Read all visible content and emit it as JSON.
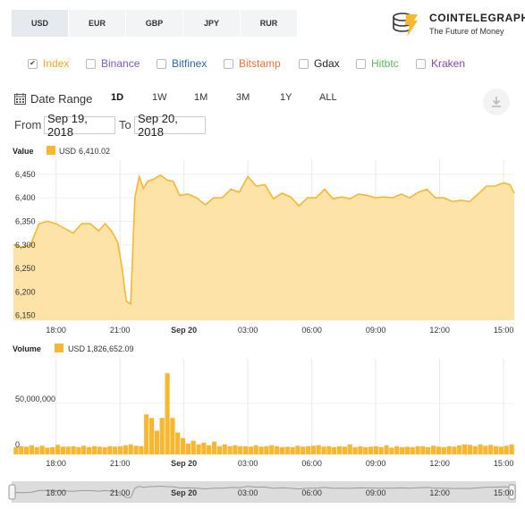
{
  "currency_tabs": [
    {
      "label": "USD",
      "active": true
    },
    {
      "label": "EUR",
      "active": false
    },
    {
      "label": "GBP",
      "active": false
    },
    {
      "label": "JPY",
      "active": false
    },
    {
      "label": "RUR",
      "active": false
    }
  ],
  "brand": {
    "name": "COINTELEGRAPH",
    "tagline": "The Future of Money",
    "accent": "#f7b731"
  },
  "exchanges": [
    {
      "label": "Index",
      "checked": true,
      "color": "#f5a623"
    },
    {
      "label": "Binance",
      "checked": false,
      "color": "#7e57c2"
    },
    {
      "label": "Bitfinex",
      "checked": false,
      "color": "#2c6aa0"
    },
    {
      "label": "Bitstamp",
      "checked": false,
      "color": "#f0703a"
    },
    {
      "label": "Gdax",
      "checked": false,
      "color": "#222222"
    },
    {
      "label": "Hitbtc",
      "checked": false,
      "color": "#5cb85c"
    },
    {
      "label": "Kraken",
      "checked": false,
      "color": "#8e44ad"
    }
  ],
  "date_range": {
    "label": "Date Range",
    "ranges": [
      "1D",
      "1W",
      "1M",
      "3M",
      "1Y",
      "ALL"
    ],
    "active": "1D",
    "from_label": "From",
    "from_value": "Sep 19, 2018",
    "to_label": "To",
    "to_value": "Sep 20, 2018"
  },
  "chart_data": [
    {
      "type": "area",
      "title": "Value",
      "legend": {
        "name": "USD",
        "value": "6,410.02"
      },
      "x_ticks": [
        "18:00",
        "21:00",
        "Sep 20",
        "03:00",
        "06:00",
        "09:00",
        "12:00",
        "15:00"
      ],
      "y_ticks": [
        "6,150",
        "6,200",
        "6,250",
        "6,300",
        "6,350",
        "6,400",
        "6,450"
      ],
      "ylim": [
        6140,
        6480
      ],
      "xlim": [
        16.0,
        39.5
      ],
      "x": [
        16.0,
        16.4,
        16.8,
        17.2,
        17.6,
        18.0,
        18.4,
        18.8,
        19.2,
        19.6,
        20.0,
        20.3,
        20.6,
        20.9,
        21.1,
        21.3,
        21.5,
        21.7,
        21.9,
        22.1,
        22.3,
        22.6,
        22.9,
        23.2,
        23.5,
        23.8,
        24.2,
        24.6,
        25.0,
        25.4,
        25.8,
        26.2,
        26.6,
        27.0,
        27.4,
        27.8,
        28.2,
        28.6,
        29.0,
        29.4,
        29.8,
        30.2,
        30.6,
        31.0,
        31.4,
        31.8,
        32.2,
        32.6,
        33.0,
        33.4,
        33.8,
        34.2,
        34.6,
        35.0,
        35.4,
        35.8,
        36.2,
        36.6,
        37.0,
        37.4,
        37.8,
        38.2,
        38.6,
        39.0,
        39.3,
        39.5
      ],
      "y": [
        6300,
        6295,
        6300,
        6345,
        6350,
        6345,
        6335,
        6325,
        6345,
        6345,
        6330,
        6345,
        6330,
        6305,
        6250,
        6180,
        6175,
        6400,
        6445,
        6420,
        6435,
        6440,
        6448,
        6438,
        6435,
        6405,
        6408,
        6400,
        6385,
        6400,
        6400,
        6418,
        6412,
        6445,
        6425,
        6428,
        6398,
        6410,
        6402,
        6383,
        6400,
        6400,
        6418,
        6398,
        6402,
        6398,
        6408,
        6405,
        6400,
        6402,
        6400,
        6408,
        6400,
        6412,
        6418,
        6400,
        6400,
        6392,
        6395,
        6392,
        6408,
        6425,
        6425,
        6432,
        6428,
        6410
      ],
      "color": "#f7b731",
      "fill": "#fde3a8"
    },
    {
      "type": "bar",
      "title": "Volume",
      "legend": {
        "name": "USD",
        "value": "1,826,652.09"
      },
      "x_ticks": [
        "18:00",
        "21:00",
        "Sep 20",
        "03:00",
        "06:00",
        "09:00",
        "12:00",
        "15:00"
      ],
      "y_ticks": [
        "0",
        "50,000,000"
      ],
      "ylim": [
        -6000000,
        99000000
      ],
      "xlim": [
        16.0,
        39.5
      ],
      "values": [
        2000000,
        3000000,
        2500000,
        4000000,
        2000000,
        3500000,
        1500000,
        2000000,
        4500000,
        2500000,
        2500000,
        3000000,
        2000000,
        3500000,
        2000000,
        3000000,
        2500000,
        2000000,
        3000000,
        2500000,
        3000000,
        4000000,
        5000000,
        3500000,
        3000000,
        38000000,
        34000000,
        20000000,
        34000000,
        83000000,
        34000000,
        18000000,
        12000000,
        6000000,
        9000000,
        5000000,
        7000000,
        4000000,
        8000000,
        3000000,
        5000000,
        3000000,
        4000000,
        3000000,
        3000000,
        2500000,
        4000000,
        2500000,
        3000000,
        4000000,
        3000000,
        2000000,
        2500000,
        2000000,
        3500000,
        2500000,
        3000000,
        3500000,
        4000000,
        2500000,
        3000000,
        2000000,
        3000000,
        2500000,
        5000000,
        2000000,
        3000000,
        2000000,
        2500000,
        3000000,
        2000000,
        4000000,
        1500000,
        3000000,
        2000000,
        2500000,
        2000000,
        3000000,
        3000000,
        2000000,
        3500000,
        2500000,
        2000000,
        3000000,
        2500000,
        4000000,
        5000000,
        4500000,
        3000000,
        5000000,
        3500000,
        4500000,
        3000000,
        2500000,
        3500000,
        5000000
      ],
      "color": "#f7b731"
    }
  ],
  "navigator": {
    "x_ticks": [
      "18:00",
      "21:00",
      "Sep 20",
      "03:00",
      "06:00",
      "09:00",
      "12:00",
      "15:00"
    ]
  },
  "icons": {
    "calendar": "calendar-icon",
    "download": "download-icon",
    "logo": "cointelegraph-logo-icon"
  }
}
